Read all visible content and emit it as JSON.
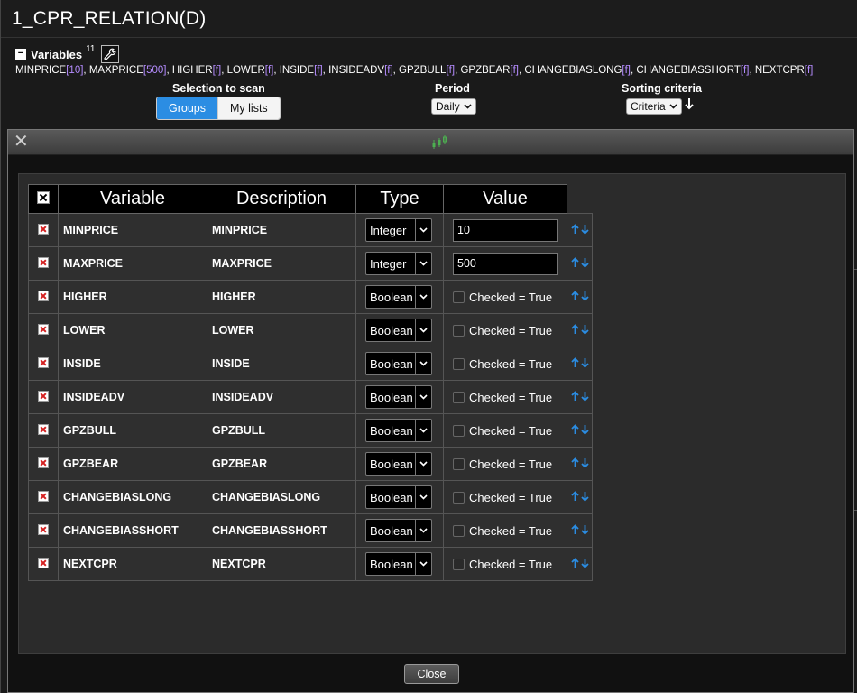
{
  "window": {
    "title": "1_CPR_RELATION(D)"
  },
  "variables": {
    "label": "Variables",
    "count": "11",
    "summary": [
      {
        "name": "MINPRICE",
        "param": "[10]"
      },
      {
        "name": "MAXPRICE",
        "param": "[500]"
      },
      {
        "name": "HIGHER",
        "param": "[f]"
      },
      {
        "name": "LOWER",
        "param": "[f]"
      },
      {
        "name": "INSIDE",
        "param": "[f]"
      },
      {
        "name": "INSIDEADV",
        "param": "[f]"
      },
      {
        "name": "GPZBULL",
        "param": "[f]"
      },
      {
        "name": "GPZBEAR",
        "param": "[f]"
      },
      {
        "name": "CHANGEBIASLONG",
        "param": "[f]"
      },
      {
        "name": "CHANGEBIASSHORT",
        "param": "[f]"
      },
      {
        "name": "NEXTCPR",
        "param": "[f]"
      }
    ]
  },
  "scan": {
    "selection_label": "Selection to scan",
    "groups_label": "Groups",
    "mylists_label": "My lists",
    "period_label": "Period",
    "period_value": "Daily",
    "sorting_label": "Sorting criteria",
    "sorting_value": "Criteria"
  },
  "modal": {
    "close_label": "Close",
    "columns": [
      "Variable",
      "Description",
      "Type",
      "Value"
    ],
    "rows": [
      {
        "variable": "MINPRICE",
        "description": "MINPRICE",
        "type": "Integer",
        "value": "10"
      },
      {
        "variable": "MAXPRICE",
        "description": "MAXPRICE",
        "type": "Integer",
        "value": "500"
      },
      {
        "variable": "HIGHER",
        "description": "HIGHER",
        "type": "Boolean",
        "value": "Checked = True"
      },
      {
        "variable": "LOWER",
        "description": "LOWER",
        "type": "Boolean",
        "value": "Checked = True"
      },
      {
        "variable": "INSIDE",
        "description": "INSIDE",
        "type": "Boolean",
        "value": "Checked = True"
      },
      {
        "variable": "INSIDEADV",
        "description": "INSIDEADV",
        "type": "Boolean",
        "value": "Checked = True"
      },
      {
        "variable": "GPZBULL",
        "description": "GPZBULL",
        "type": "Boolean",
        "value": "Checked = True"
      },
      {
        "variable": "GPZBEAR",
        "description": "GPZBEAR",
        "type": "Boolean",
        "value": "Checked = True"
      },
      {
        "variable": "CHANGEBIASLONG",
        "description": "CHANGEBIASLONG",
        "type": "Boolean",
        "value": "Checked = True"
      },
      {
        "variable": "CHANGEBIASSHORT",
        "description": "CHANGEBIASSHORT",
        "type": "Boolean",
        "value": "Checked = True"
      },
      {
        "variable": "NEXTCPR",
        "description": "NEXTCPR",
        "type": "Boolean",
        "value": "Checked = True"
      }
    ]
  },
  "colors": {
    "accent": "#2b8de3",
    "param": "#b58cff",
    "delete": "#d42020",
    "logo": "#4caf50"
  },
  "icons": {
    "collapse": "minus-box-icon",
    "wrench": "wrench-icon",
    "close": "close-x-icon",
    "logo": "candlestick-logo-icon",
    "delete": "delete-x-icon",
    "up": "arrow-up-icon",
    "down": "arrow-down-icon"
  }
}
